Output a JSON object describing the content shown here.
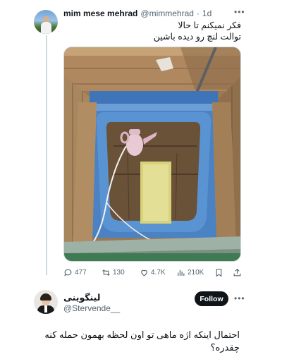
{
  "tweet": {
    "author_name": "mim mese mehrad",
    "author_handle": "@mimmehrad",
    "separator": "·",
    "time": "1d",
    "text_lines": [
      "فکر نمیکنم تا حالا",
      "توالت لنچ رو دیده باشین"
    ],
    "stats": {
      "replies": "477",
      "retweets": "130",
      "likes": "4.7K",
      "views": "210K"
    }
  },
  "reply": {
    "author_name": "لینگوینی",
    "author_handle": "@Stervende__",
    "follow_label": "Follow",
    "text_lines": [
      "احتمال اینکه اژه ماهی تو اون لحظه بهمون حمله کنه",
      "چقدره؟"
    ]
  },
  "icons": {
    "reply": "comment-icon",
    "retweet": "retweet-icon",
    "like": "heart-icon",
    "views": "analytics-icon",
    "bookmark": "bookmark-icon",
    "share": "share-icon",
    "more": "more-dots-icon"
  },
  "colors": {
    "text_primary": "#0f1419",
    "text_secondary": "#536471",
    "thread_line": "#cfd9de",
    "button_bg": "#0f1419"
  }
}
